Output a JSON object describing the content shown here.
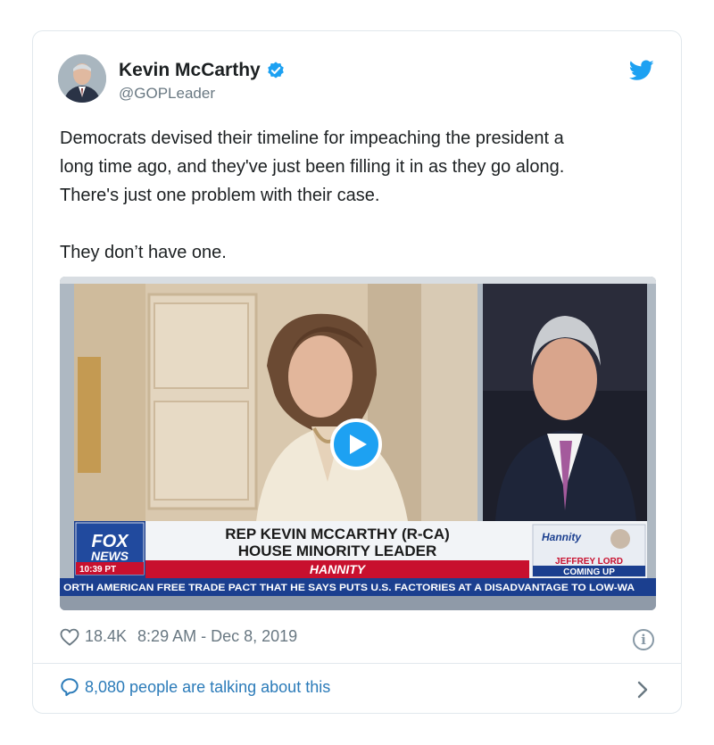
{
  "tweet": {
    "author_name": "Kevin McCarthy",
    "handle": "@GOPLeader",
    "text_lines": [
      "Democrats devised their timeline for impeaching the president a",
      "long time ago, and they've just been filling it in as they go along.",
      "There's just one problem with their case."
    ],
    "text_last": "They don’t have one.",
    "likes": "18.4K",
    "timestamp": "8:29 AM - Dec 8, 2019",
    "conversation": "8,080 people are talking about this",
    "info_glyph": "i"
  },
  "video": {
    "network_logo_line1": "FOX",
    "network_logo_line2": "NEWS",
    "clock": "10:39 PT",
    "lower_third_line1": "REP KEVIN MCCARTHY (R-CA)",
    "lower_third_line2": "HOUSE MINORITY LEADER",
    "show_name": "HANNITY",
    "promo_show": "Hannity",
    "promo_guest": "JEFFREY LORD",
    "promo_status": "COMING UP",
    "ticker": "ORTH AMERICAN FREE TRADE PACT THAT HE SAYS PUTS U.S. FACTORIES AT A DISADVANTAGE TO LOW-WA"
  },
  "colors": {
    "accent": "#1da1f2",
    "link": "#2b7bb9",
    "muted": "#697882",
    "fox_red": "#c8102e",
    "fox_blue": "#1b3f8f"
  },
  "icons": [
    "avatar",
    "verified-badge-icon",
    "twitter-bird-icon",
    "play-icon",
    "heart-icon",
    "info-icon",
    "speech-bubble-icon",
    "chevron-right-icon"
  ]
}
